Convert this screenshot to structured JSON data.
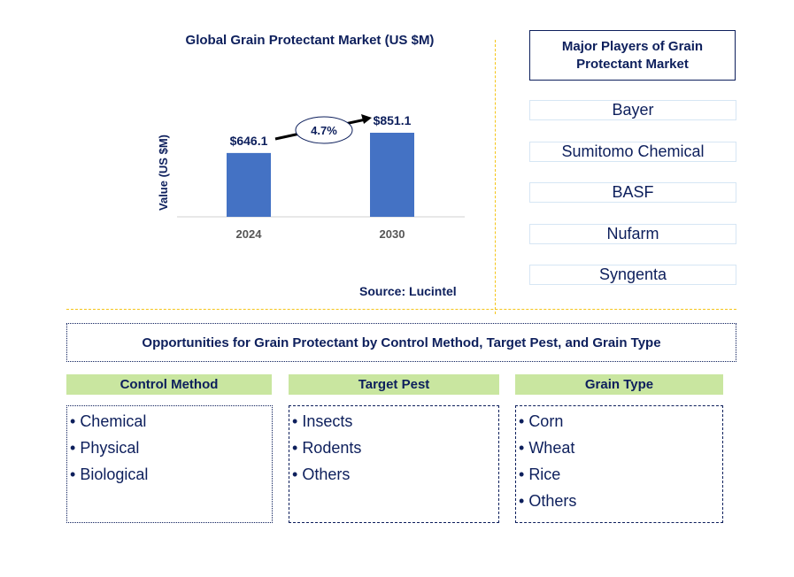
{
  "chart_data": {
    "type": "bar",
    "title": "Global Grain Protectant Market (US $M)",
    "xlabel": "",
    "ylabel": "Value (US $M)",
    "categories": [
      "2024",
      "2030"
    ],
    "values": [
      646.1,
      851.1
    ],
    "data_labels": [
      "$646.1",
      "$851.1"
    ],
    "ylim": [
      0,
      1000
    ],
    "grid": false,
    "bar_color": "#4472c4",
    "annotation": {
      "label": "4.7%",
      "type": "CAGR arrow",
      "from": "2024",
      "to": "2030"
    }
  },
  "source": "Source: Lucintel",
  "players": {
    "title": "Major Players of Grain Protectant Market",
    "items": [
      "Bayer",
      "Sumitomo Chemical",
      "BASF",
      "Nufarm",
      "Syngenta"
    ]
  },
  "opportunities": {
    "title": "Opportunities for Grain Protectant by Control Method, Target Pest, and Grain Type",
    "categories": [
      {
        "label": "Control Method",
        "items": [
          "Chemical",
          "Physical",
          "Biological"
        ]
      },
      {
        "label": "Target Pest",
        "items": [
          "Insects",
          "Rodents",
          "Others"
        ]
      },
      {
        "label": "Grain Type",
        "items": [
          "Corn",
          "Wheat",
          "Rice",
          "Others"
        ]
      }
    ]
  },
  "colors": {
    "navy": "#0d1f5c",
    "bar": "#4472c4",
    "header_green": "#c9e6a0",
    "separator": "#f5c518"
  }
}
